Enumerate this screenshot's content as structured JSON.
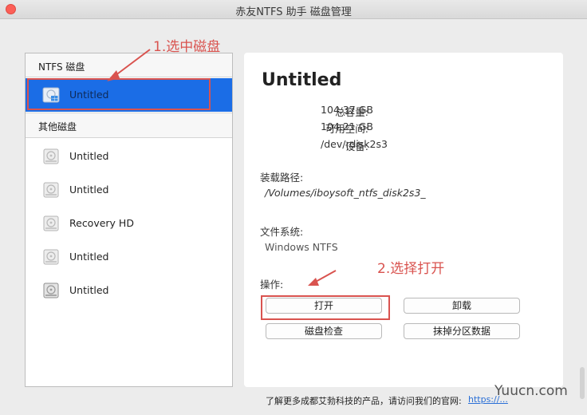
{
  "window": {
    "title": "赤友NTFS 助手 磁盘管理"
  },
  "sidebar": {
    "ntfs_header": "NTFS 磁盘",
    "ntfs_disks": [
      {
        "label": "Untitled"
      }
    ],
    "other_header": "其他磁盘",
    "other_disks": [
      {
        "label": "Untitled"
      },
      {
        "label": "Untitled"
      },
      {
        "label": "Recovery HD"
      },
      {
        "label": "Untitled"
      },
      {
        "label": "Untitled"
      }
    ]
  },
  "details": {
    "title": "Untitled",
    "capacity_label": "总容量:",
    "capacity_value": "104.37 GB",
    "available_label": "可用空间:",
    "available_value": "104.21 GB",
    "device_label": "设备:",
    "device_value": "/dev/rdisk2s3",
    "mount_label": "装载路径:",
    "mount_value": "/Volumes/iboysoft_ntfs_disk2s3_",
    "fs_label": "文件系统:",
    "fs_value": "Windows NTFS",
    "ops_label": "操作:",
    "buttons": {
      "open": "打开",
      "unmount": "卸载",
      "check": "磁盘检查",
      "erase": "抹掉分区数据"
    }
  },
  "annotations": {
    "step1": "1.选中磁盘",
    "step2": "2.选择打开",
    "color": "#d9534f"
  },
  "footer": {
    "text": "了解更多成都艾勃科技的产品，请访问我们的官网:",
    "link": "https://...",
    "watermark": "Yuucn.com"
  },
  "colors": {
    "selection": "#1b6de6",
    "close": "#fc5f57"
  }
}
